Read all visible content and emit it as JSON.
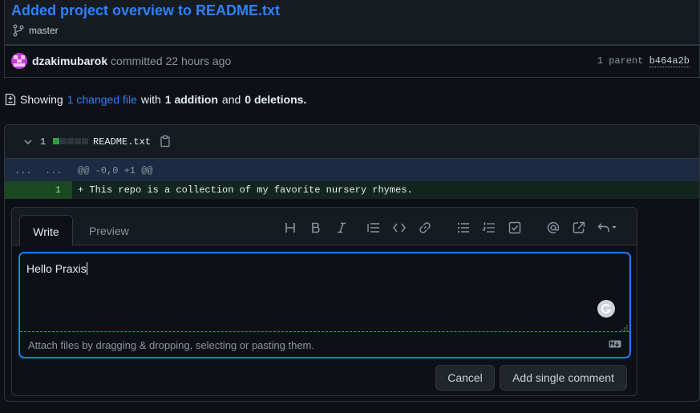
{
  "commit": {
    "title": "Added project overview to README.txt",
    "branch": "master",
    "author": "dzakimubarok",
    "committed_text": "committed 22 hours ago",
    "parent_label": "1 parent",
    "parent_hash": "b464a2b"
  },
  "summary": {
    "showing": "Showing",
    "changed_files": "1 changed file",
    "with": "with",
    "additions": "1 addition",
    "and": "and",
    "deletions": "0 deletions."
  },
  "file": {
    "change_count": "1",
    "name": "README.txt",
    "diffstat": [
      "#2ea043",
      "#30363d",
      "#30363d",
      "#30363d",
      "#30363d"
    ],
    "hunk_left": "...",
    "hunk_right": "...",
    "hunk_header": "@@ -0,0 +1 @@",
    "added_line_number": "1",
    "added_line": "+ This repo is a collection of my favorite nursery rhymes."
  },
  "comment": {
    "tab_write": "Write",
    "tab_preview": "Preview",
    "toolbar_icons": [
      "heading-icon",
      "bold-icon",
      "italic-icon",
      "quote-icon",
      "code-icon",
      "link-icon",
      "bulleted-list-icon",
      "numbered-list-icon",
      "task-list-icon",
      "mention-icon",
      "cross-reference-icon",
      "saved-replies-icon"
    ],
    "text_value": "Hello Praxis",
    "attach_hint": "Attach files by dragging & dropping, selecting or pasting them.",
    "cancel_label": "Cancel",
    "submit_label": "Add single comment"
  },
  "colors": {
    "accent": "#2f81f7",
    "addition": "#2ea043",
    "background": "#0d1117"
  }
}
